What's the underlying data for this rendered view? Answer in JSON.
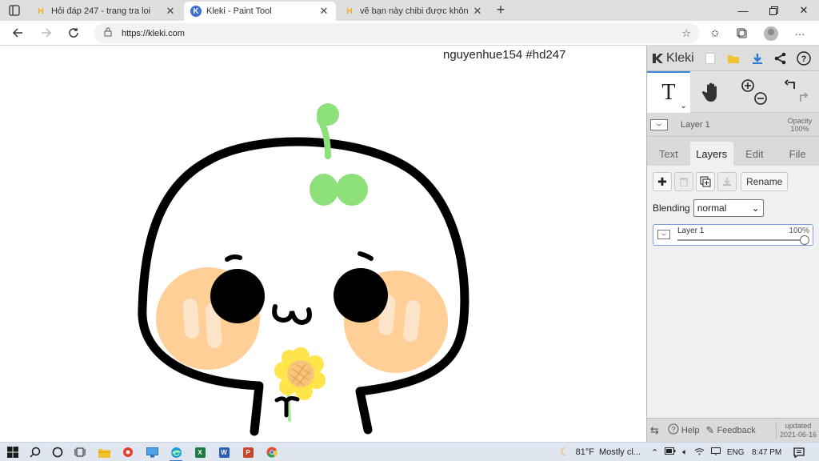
{
  "browser": {
    "tabs": [
      {
        "title": "Hỏi đáp 247 - trang tra loi",
        "favicon": "H",
        "active": false
      },
      {
        "title": "Kleki - Paint Tool",
        "favicon": "K",
        "active": true
      },
      {
        "title": "vẽ bạn này chibi được không cá...",
        "favicon": "H",
        "active": false
      }
    ],
    "url": "https://kleki.com",
    "colors": {
      "accent": "#3b87d8",
      "hoidap": "#f2b01e"
    }
  },
  "canvas": {
    "watermark": "nguyenhue154 #hd247"
  },
  "panel": {
    "logo": "Kleki",
    "layer_row": {
      "name": "Layer 1",
      "opacity_label": "Opacity",
      "opacity_value": "100%"
    },
    "tabs": [
      "Text",
      "Layers",
      "Edit",
      "File"
    ],
    "selected_tab": "Layers",
    "rename_label": "Rename",
    "blending_label": "Blending",
    "blending_value": "normal",
    "layer_item": {
      "name": "Layer 1",
      "opacity": "100%",
      "opacity_fraction": 1.0
    },
    "footer": {
      "help": "Help",
      "feedback": "Feedback",
      "updated_label": "updated",
      "updated_date": "2021-06-16"
    }
  },
  "taskbar": {
    "weather_temp": "81°F",
    "weather_desc": "Mostly cl...",
    "language": "ENG",
    "time": "8:47 PM"
  }
}
